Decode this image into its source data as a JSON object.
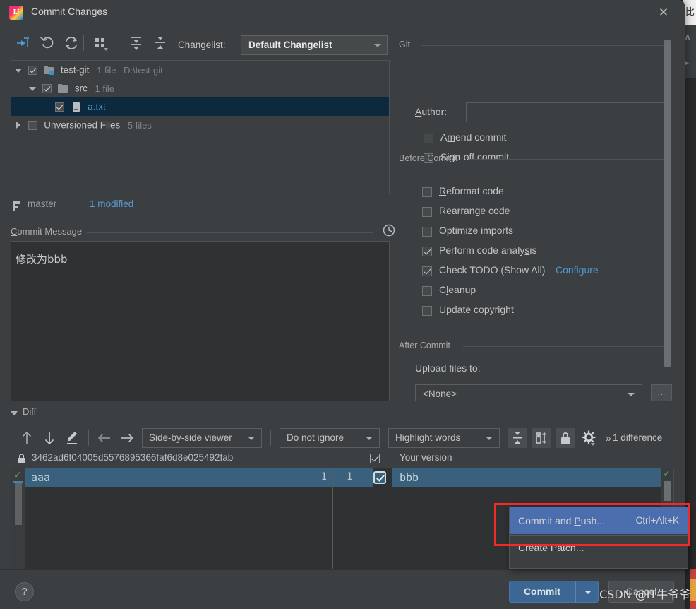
{
  "window": {
    "title": "Commit Changes",
    "app_icon": "intellij-idea-icon",
    "close_icon": "✕"
  },
  "toolbar": {
    "icons": [
      {
        "name": "show-diff-icon",
        "label": "Show Diff"
      },
      {
        "name": "revert-icon",
        "label": "Revert"
      },
      {
        "name": "refresh-icon",
        "label": "Refresh"
      },
      {
        "name": "group-by-icon",
        "label": "Group By"
      },
      {
        "name": "expand-all-icon",
        "label": "Expand All"
      },
      {
        "name": "collapse-all-icon",
        "label": "Collapse All"
      }
    ],
    "changelist_label": "Changelist:",
    "changelist_mnemonic": "s",
    "changelist_value": "Default Changelist"
  },
  "tree": {
    "rows": [
      {
        "name": "test-git",
        "meta": "1 file",
        "path": "D:\\test-git",
        "checked": true,
        "expanded": true,
        "indent": 4,
        "icon": "folder-vcs-icon",
        "selected": false,
        "link": false
      },
      {
        "name": "src",
        "meta": "1 file",
        "path": "",
        "checked": true,
        "expanded": true,
        "indent": 24,
        "icon": "folder-icon",
        "selected": false,
        "link": false
      },
      {
        "name": "a.txt",
        "meta": "",
        "path": "",
        "checked": true,
        "expanded": null,
        "indent": 62,
        "icon": "text-file-icon",
        "selected": true,
        "link": true
      },
      {
        "name": "Unversioned Files",
        "meta": "5 files",
        "path": "",
        "checked": false,
        "expanded": false,
        "indent": 4,
        "icon": "",
        "selected": false,
        "link": false
      }
    ]
  },
  "branch": {
    "icon": "branch-icon",
    "name": "master",
    "modified": "1 modified"
  },
  "commit_message": {
    "title": "Commit Message",
    "mnemonic": "C",
    "history_icon": "clock-icon",
    "value": "修改为bbb"
  },
  "options": {
    "groups": [
      {
        "title": "Git"
      },
      {
        "title": "Before Commit"
      },
      {
        "title": "After Commit"
      }
    ],
    "author_label": "Author:",
    "author_mnemonic": "A",
    "author_value": "",
    "git_checkboxes": [
      {
        "label": "Amend commit",
        "checked": false,
        "mnemonic": "m"
      },
      {
        "label": "Sign-off commit",
        "checked": false,
        "mnemonic": "g"
      }
    ],
    "before_commit_checkboxes": [
      {
        "label": "Reformat code",
        "checked": false,
        "mnemonic": "R",
        "link": ""
      },
      {
        "label": "Rearrange code",
        "checked": false,
        "mnemonic": "n",
        "link": ""
      },
      {
        "label": "Optimize imports",
        "checked": false,
        "mnemonic": "O",
        "link": ""
      },
      {
        "label": "Perform code analysis",
        "checked": true,
        "mnemonic": "s",
        "link": ""
      },
      {
        "label": "Check TODO (Show All)",
        "checked": true,
        "mnemonic": "",
        "link": "Configure"
      },
      {
        "label": "Cleanup",
        "checked": false,
        "mnemonic": "l",
        "link": ""
      },
      {
        "label": "Update copyright",
        "checked": false,
        "mnemonic": "",
        "link": ""
      }
    ],
    "upload_label": "Upload files to:",
    "upload_value": "<None>",
    "browse_label": "..."
  },
  "diff": {
    "section_title": "Diff",
    "toolbar": {
      "prev_diff_icon": "arrow-up-icon",
      "next_diff_icon": "arrow-down-icon",
      "edit_icon": "pencil-icon",
      "accept_left_icon": "arrow-left-icon",
      "accept_right_icon": "arrow-right-icon",
      "viewer_mode": "Side-by-side viewer",
      "ignore_mode": "Do not ignore",
      "highlight_mode": "Highlight words",
      "collapse_unchanged_icon": "collapse-lines-icon",
      "sync_scroll_icon": "sync-scroll-icon",
      "readonly_icon": "lock-icon",
      "settings_icon": "gear-icon",
      "more_icon": "»",
      "difference_count": "1 difference"
    },
    "left_header": {
      "lock_icon": "lock-icon",
      "revision": "3462ad6f04005d5576895366faf6d8e025492fab"
    },
    "right_header": {
      "checkbox_checked": true,
      "label": "Your version"
    },
    "left_line_number": "1",
    "right_line_number": "1",
    "left_content": "aaa",
    "right_content": "bbb",
    "accept_checkbox_checked": true
  },
  "context_menu": {
    "items": [
      {
        "label": "Commit and Push...",
        "shortcut": "Ctrl+Alt+K",
        "selected": true,
        "mnemonic": "P"
      },
      {
        "label": "Create Patch...",
        "shortcut": "",
        "selected": false,
        "mnemonic": ""
      }
    ],
    "highlight_color": "#f42a2a"
  },
  "bottom": {
    "help_label": "?",
    "commit_label": "Commit",
    "commit_mnemonic": "i",
    "commit_dropdown_icon": "chevron-down-icon",
    "cancel_label": "Cancel"
  },
  "watermark": {
    "text": "CSDN @IT牛爷爷"
  },
  "colors": {
    "dialog_bg": "#3c3f41",
    "editor_bg": "#2b2b2b",
    "accent_blue": "#4a9ad4",
    "selection_blue": "#39617d",
    "menu_selection": "#4b6eaf",
    "commit_button": "#3c6795",
    "highlight_red": "#f42a2a",
    "check_green": "#5aaa5a"
  }
}
